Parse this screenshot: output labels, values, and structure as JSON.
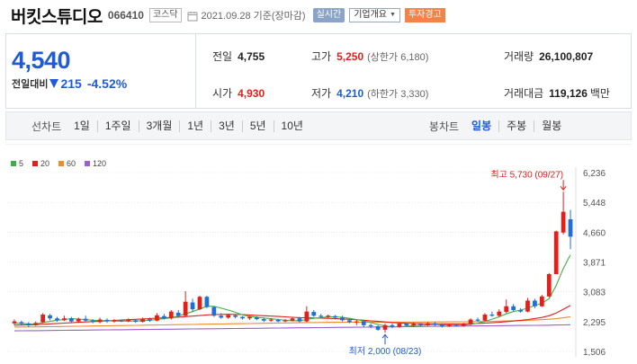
{
  "header": {
    "stock_name": "버킷스튜디오",
    "stock_code": "066410",
    "market": "코스닥",
    "date_text": "2021.09.28 기준(장마감)",
    "realtime_label": "실시간",
    "company_label": "기업개요",
    "warning_label": "투자경고"
  },
  "price": {
    "current": "4,540",
    "change_label": "전일대비",
    "change_amount": "215",
    "change_rate": "-4.52%",
    "direction": "down",
    "color_down": "#1f5bd6",
    "color_up": "#e0201b"
  },
  "stats": {
    "prev_close_label": "전일",
    "prev_close": "4,755",
    "high_label": "고가",
    "high": "5,250",
    "upper_limit": "(상한가 6,180)",
    "volume_label": "거래량",
    "volume": "26,100,807",
    "open_label": "시가",
    "open": "4,930",
    "low_label": "저가",
    "low": "4,210",
    "lower_limit": "(하한가 3,330)",
    "amount_label": "거래대금",
    "amount": "119,126",
    "amount_unit": "백만"
  },
  "periods": {
    "line_title": "선차트",
    "line_options": [
      "1일",
      "1주일",
      "3개월",
      "1년",
      "3년",
      "5년",
      "10년"
    ],
    "candle_title": "봉차트",
    "candle_options": [
      "일봉",
      "주봉",
      "월봉"
    ],
    "active_candle": "일봉"
  },
  "chart_data": {
    "type": "candlestick",
    "legend": [
      {
        "label": "5",
        "color": "#3cb043"
      },
      {
        "label": "20",
        "color": "#e0201b"
      },
      {
        "label": "60",
        "color": "#f08a2a"
      },
      {
        "label": "120",
        "color": "#9b5fd1"
      }
    ],
    "y_ticks": [
      "6,236",
      "5,448",
      "4,660",
      "3,871",
      "3,083",
      "2,295",
      "1,506"
    ],
    "y_tick_values": [
      6236,
      5448,
      4660,
      3871,
      3083,
      2295,
      1506
    ],
    "ylim": [
      1506,
      6236
    ],
    "high_annotation": "최고 5,730 (09/27)",
    "low_annotation": "최저 2,000 (08/23)",
    "candles": [
      [
        2250,
        2300,
        2200,
        2350
      ],
      [
        2280,
        2240,
        2190,
        2320
      ],
      [
        2240,
        2200,
        2150,
        2280
      ],
      [
        2200,
        2260,
        2180,
        2300
      ],
      [
        2280,
        2480,
        2250,
        2520
      ],
      [
        2460,
        2380,
        2330,
        2500
      ],
      [
        2380,
        2330,
        2290,
        2420
      ],
      [
        2330,
        2380,
        2310,
        2450
      ],
      [
        2380,
        2300,
        2270,
        2420
      ],
      [
        2300,
        2370,
        2260,
        2400
      ],
      [
        2370,
        2320,
        2290,
        2450
      ],
      [
        2320,
        2280,
        2250,
        2360
      ],
      [
        2280,
        2350,
        2250,
        2400
      ],
      [
        2340,
        2300,
        2260,
        2380
      ],
      [
        2300,
        2330,
        2270,
        2360
      ],
      [
        2320,
        2300,
        2280,
        2350
      ],
      [
        2300,
        2340,
        2280,
        2380
      ],
      [
        2330,
        2290,
        2260,
        2360
      ],
      [
        2290,
        2370,
        2270,
        2400
      ],
      [
        2360,
        2320,
        2290,
        2400
      ],
      [
        2320,
        2460,
        2300,
        2520
      ],
      [
        2440,
        2380,
        2350,
        2500
      ],
      [
        2380,
        2560,
        2350,
        2600
      ],
      [
        2530,
        2450,
        2400,
        2600
      ],
      [
        2450,
        2820,
        2430,
        3100
      ],
      [
        2800,
        2620,
        2560,
        2900
      ],
      [
        2620,
        2950,
        2600,
        2980
      ],
      [
        2950,
        2680,
        2650,
        2980
      ],
      [
        2680,
        2450,
        2420,
        2700
      ],
      [
        2450,
        2400,
        2370,
        2520
      ],
      [
        2400,
        2470,
        2370,
        2500
      ],
      [
        2460,
        2420,
        2380,
        2480
      ],
      [
        2420,
        2380,
        2350,
        2440
      ],
      [
        2380,
        2420,
        2340,
        2450
      ],
      [
        2410,
        2360,
        2330,
        2430
      ],
      [
        2360,
        2320,
        2280,
        2400
      ],
      [
        2320,
        2350,
        2290,
        2380
      ],
      [
        2340,
        2300,
        2280,
        2370
      ],
      [
        2300,
        2330,
        2280,
        2360
      ],
      [
        2320,
        2380,
        2300,
        2400
      ],
      [
        2380,
        2300,
        2270,
        2420
      ],
      [
        2300,
        2560,
        2280,
        2700
      ],
      [
        2550,
        2450,
        2420,
        2600
      ],
      [
        2450,
        2420,
        2380,
        2500
      ],
      [
        2420,
        2450,
        2380,
        2480
      ],
      [
        2440,
        2400,
        2350,
        2470
      ],
      [
        2400,
        2330,
        2300,
        2450
      ],
      [
        2330,
        2280,
        2250,
        2380
      ],
      [
        2280,
        2300,
        2200,
        2340
      ],
      [
        2300,
        2200,
        2150,
        2330
      ],
      [
        2200,
        2170,
        2120,
        2240
      ],
      [
        2170,
        2080,
        2050,
        2200
      ],
      [
        2080,
        2200,
        2000,
        2240
      ],
      [
        2200,
        2160,
        2120,
        2240
      ],
      [
        2160,
        2240,
        2130,
        2260
      ],
      [
        2240,
        2190,
        2160,
        2260
      ],
      [
        2190,
        2230,
        2150,
        2270
      ],
      [
        2230,
        2200,
        2170,
        2260
      ],
      [
        2200,
        2250,
        2180,
        2280
      ],
      [
        2250,
        2210,
        2180,
        2280
      ],
      [
        2210,
        2170,
        2140,
        2250
      ],
      [
        2170,
        2210,
        2150,
        2240
      ],
      [
        2210,
        2180,
        2160,
        2240
      ],
      [
        2180,
        2230,
        2160,
        2260
      ],
      [
        2230,
        2350,
        2200,
        2380
      ],
      [
        2350,
        2320,
        2290,
        2400
      ],
      [
        2320,
        2480,
        2300,
        2520
      ],
      [
        2480,
        2450,
        2420,
        2560
      ],
      [
        2450,
        2560,
        2420,
        2620
      ],
      [
        2550,
        2700,
        2520,
        2880
      ],
      [
        2700,
        2600,
        2560,
        2760
      ],
      [
        2600,
        2560,
        2530,
        2650
      ],
      [
        2560,
        2850,
        2540,
        2920
      ],
      [
        2850,
        2700,
        2650,
        2900
      ],
      [
        2700,
        2960,
        2680,
        3000
      ],
      [
        2960,
        3550,
        2940,
        3580
      ],
      [
        3550,
        4680,
        3550,
        4700
      ],
      [
        4650,
        5200,
        4600,
        5730
      ],
      [
        5000,
        4540,
        4210,
        5250
      ]
    ],
    "ma5": [
      2250,
      2245,
      2235,
      2230,
      2270,
      2300,
      2330,
      2350,
      2370,
      2360,
      2350,
      2330,
      2320,
      2320,
      2310,
      2310,
      2310,
      2310,
      2320,
      2330,
      2350,
      2370,
      2400,
      2440,
      2500,
      2560,
      2630,
      2700,
      2700,
      2650,
      2600,
      2540,
      2470,
      2430,
      2410,
      2390,
      2370,
      2350,
      2330,
      2320,
      2320,
      2350,
      2380,
      2400,
      2420,
      2420,
      2410,
      2380,
      2350,
      2310,
      2270,
      2220,
      2180,
      2160,
      2160,
      2170,
      2190,
      2200,
      2210,
      2220,
      2210,
      2200,
      2200,
      2200,
      2220,
      2250,
      2300,
      2360,
      2420,
      2500,
      2560,
      2600,
      2650,
      2720,
      2780,
      2900,
      3250,
      3700,
      4060
    ],
    "ma20": [
      2200,
      2205,
      2210,
      2215,
      2225,
      2235,
      2245,
      2255,
      2265,
      2275,
      2285,
      2295,
      2305,
      2315,
      2325,
      2335,
      2345,
      2355,
      2365,
      2375,
      2385,
      2395,
      2405,
      2415,
      2425,
      2440,
      2455,
      2470,
      2480,
      2485,
      2487,
      2485,
      2480,
      2470,
      2460,
      2450,
      2440,
      2430,
      2420,
      2410,
      2400,
      2395,
      2390,
      2385,
      2380,
      2375,
      2365,
      2355,
      2345,
      2330,
      2315,
      2300,
      2285,
      2270,
      2260,
      2250,
      2245,
      2240,
      2238,
      2236,
      2235,
      2234,
      2234,
      2236,
      2240,
      2246,
      2254,
      2264,
      2276,
      2292,
      2310,
      2328,
      2350,
      2376,
      2404,
      2450,
      2520,
      2620,
      2720
    ],
    "ma60": [
      2150,
      2152,
      2154,
      2156,
      2158,
      2160,
      2163,
      2166,
      2169,
      2172,
      2175,
      2178,
      2181,
      2184,
      2187,
      2190,
      2193,
      2196,
      2199,
      2202,
      2205,
      2208,
      2211,
      2214,
      2217,
      2220,
      2223,
      2226,
      2229,
      2232,
      2235,
      2238,
      2241,
      2244,
      2247,
      2250,
      2253,
      2256,
      2259,
      2262,
      2265,
      2268,
      2270,
      2272,
      2274,
      2276,
      2278,
      2279,
      2280,
      2281,
      2282,
      2282,
      2282,
      2282,
      2282,
      2282,
      2282,
      2283,
      2284,
      2285,
      2286,
      2287,
      2288,
      2290,
      2292,
      2295,
      2298,
      2302,
      2306,
      2311,
      2316,
      2322,
      2328,
      2336,
      2344,
      2356,
      2372,
      2396,
      2424
    ],
    "ma120": [
      2050,
      2052,
      2054,
      2056,
      2058,
      2060,
      2062,
      2064,
      2066,
      2068,
      2070,
      2072,
      2074,
      2076,
      2078,
      2080,
      2082,
      2084,
      2086,
      2088,
      2090,
      2092,
      2094,
      2096,
      2098,
      2100,
      2102,
      2104,
      2106,
      2108,
      2110,
      2112,
      2114,
      2116,
      2118,
      2120,
      2122,
      2124,
      2126,
      2128,
      2130,
      2132,
      2134,
      2136,
      2138,
      2140,
      2142,
      2144,
      2146,
      2148,
      2150,
      2152,
      2154,
      2156,
      2158,
      2160,
      2162,
      2164,
      2166,
      2168,
      2170,
      2172,
      2174,
      2176,
      2178,
      2180,
      2182,
      2184,
      2186,
      2188,
      2190,
      2192,
      2194,
      2196,
      2198,
      2201,
      2204,
      2208,
      2212
    ]
  }
}
